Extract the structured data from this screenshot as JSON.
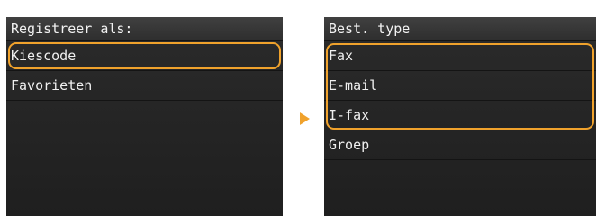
{
  "left_screen": {
    "title": "Registreer als:",
    "items": [
      {
        "label": "Kiescode"
      },
      {
        "label": "Favorieten"
      }
    ]
  },
  "right_screen": {
    "title": "Best. type",
    "items": [
      {
        "label": "Fax"
      },
      {
        "label": "E-mail"
      },
      {
        "label": "I-fax"
      },
      {
        "label": "Groep"
      }
    ]
  },
  "colors": {
    "highlight": "#f0a22c",
    "arrow": "#f0a22c",
    "screen_background": "#262626"
  },
  "icons": {
    "transition": "arrow-right-icon"
  }
}
